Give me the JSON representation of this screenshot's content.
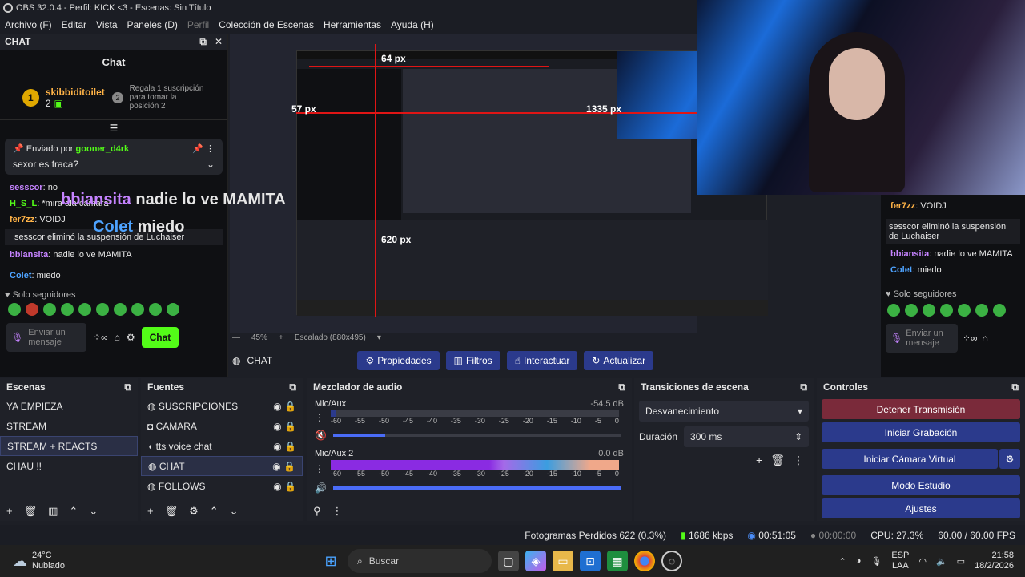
{
  "window": {
    "title": "OBS 32.0.4 - Perfil: KICK <3 - Escenas: Sin Título"
  },
  "menu": [
    "Archivo (F)",
    "Editar",
    "Vista",
    "Paneles (D)",
    "Perfil",
    "Colección de Escenas",
    "Herramientas",
    "Ayuda (H)"
  ],
  "chat": {
    "dock_title": "CHAT",
    "header": "Chat",
    "top_user": "skibbiditoilet",
    "top_rank": "1",
    "top_count": "2",
    "gift_rank": "2",
    "gift_text": "Regala 1 suscripción para tomar la posición 2",
    "pinned_label": "Enviado por",
    "pinned_user": "gooner_d4rk",
    "pinned_msg": "sexor es fraca?",
    "lines": [
      {
        "user": "sesscor",
        "sep": ":",
        "msg": "no"
      },
      {
        "user": "H_S_L",
        "sep": ":",
        "msg": "*mira ala camara*"
      },
      {
        "user": "fer7zz",
        "sep": ":",
        "msg": "VOIDJ"
      },
      {
        "user": "",
        "sep": "",
        "msg": "sesscor eliminó la suspensión de Luchaiser"
      },
      {
        "user": "bbiansita",
        "sep": ":",
        "msg": "nadie lo ve MAMITA"
      },
      {
        "user": "Colet",
        "sep": ":",
        "msg": "miedo"
      }
    ],
    "overlay_big_user": "bbiansita",
    "overlay_big_msg": "nadie lo ve MAMITA",
    "overlay_big_user2": "Colet",
    "overlay_big_msg2": "miedo",
    "followers_only": "Solo seguidores",
    "input_placeholder": "Enviar un mensaje",
    "send_label": "Chat"
  },
  "preview": {
    "zoom": "45%",
    "scaled": "Escalado (880x495)",
    "measure_top": "64 px",
    "measure_left": "57 px",
    "measure_bottom": "620 px",
    "measure_right": "1335 px"
  },
  "source_toolbar": {
    "source": "CHAT",
    "props": "Propiedades",
    "filters": "Filtros",
    "interact": "Interactuar",
    "refresh": "Actualizar"
  },
  "scenes": {
    "title": "Escenas",
    "items": [
      "YA EMPIEZA",
      "STREAM",
      "STREAM + REACTS",
      "CHAU !!"
    ],
    "selected": 2
  },
  "sources": {
    "title": "Fuentes",
    "items": [
      "SUSCRIPCIONES",
      "CAMARA",
      "tts voice chat",
      "CHAT",
      "FOLLOWS"
    ],
    "selected": 3
  },
  "mixer": {
    "title": "Mezclador de audio",
    "channels": [
      {
        "name": "Mic/Aux",
        "db": "-54.5 dB",
        "level": 0.02,
        "muted": true,
        "volume": 0.18
      },
      {
        "name": "Mic/Aux 2",
        "db": "0.0 dB",
        "level": 1.0,
        "muted": false,
        "volume": 1.0
      }
    ],
    "ticks": [
      "-60",
      "-55",
      "-50",
      "-45",
      "-40",
      "-35",
      "-30",
      "-25",
      "-20",
      "-15",
      "-10",
      "-5",
      "0"
    ]
  },
  "transitions": {
    "title": "Transiciones de escena",
    "selected": "Desvanecimiento",
    "duration_label": "Duración",
    "duration_value": "300 ms"
  },
  "controls": {
    "title": "Controles",
    "stop_stream": "Detener Transmisión",
    "start_record": "Iniciar Grabación",
    "start_vcam": "Iniciar Cámara Virtual",
    "studio": "Modo Estudio",
    "settings": "Ajustes"
  },
  "status": {
    "dropped": "Fotogramas Perdidos 622 (0.3%)",
    "kbps": "1686 kbps",
    "stream_time": "00:51:05",
    "rec_time": "00:00:00",
    "cpu": "CPU: 27.3%",
    "fps": "60.00 / 60.00 FPS"
  },
  "right_chat": {
    "lines": [
      {
        "user": "fer7zz",
        "msg": "VOIDJ"
      },
      {
        "user": "",
        "msg": "sesscor eliminó la suspensión de Luchaiser"
      },
      {
        "user": "bbiansita",
        "msg": "nadie lo ve MAMITA"
      },
      {
        "user": "Colet",
        "msg": "miedo"
      }
    ],
    "followers_only": "Solo seguidores",
    "input_placeholder": "Enviar un mensaje"
  },
  "taskbar": {
    "temp": "24°C",
    "weather": "Nublado",
    "search": "Buscar",
    "lang1": "ESP",
    "lang2": "LAA",
    "time": "21:58",
    "date": "18/2/2026"
  }
}
